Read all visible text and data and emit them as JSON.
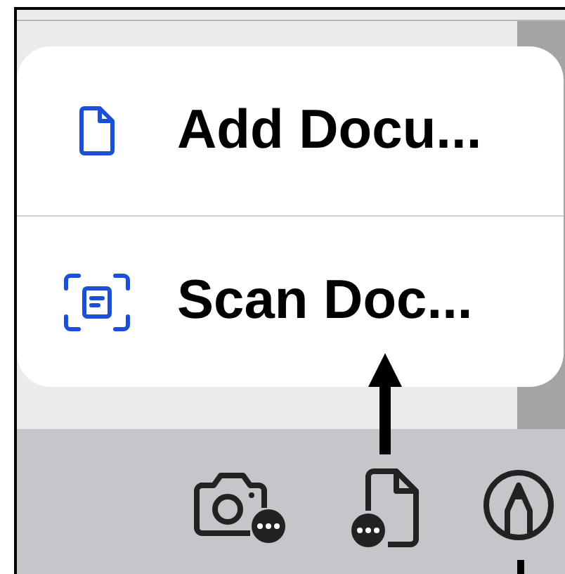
{
  "menu": {
    "items": [
      {
        "kind": "file",
        "label": "Add Docu..."
      },
      {
        "kind": "scan",
        "label": "Scan Doc..."
      }
    ]
  }
}
